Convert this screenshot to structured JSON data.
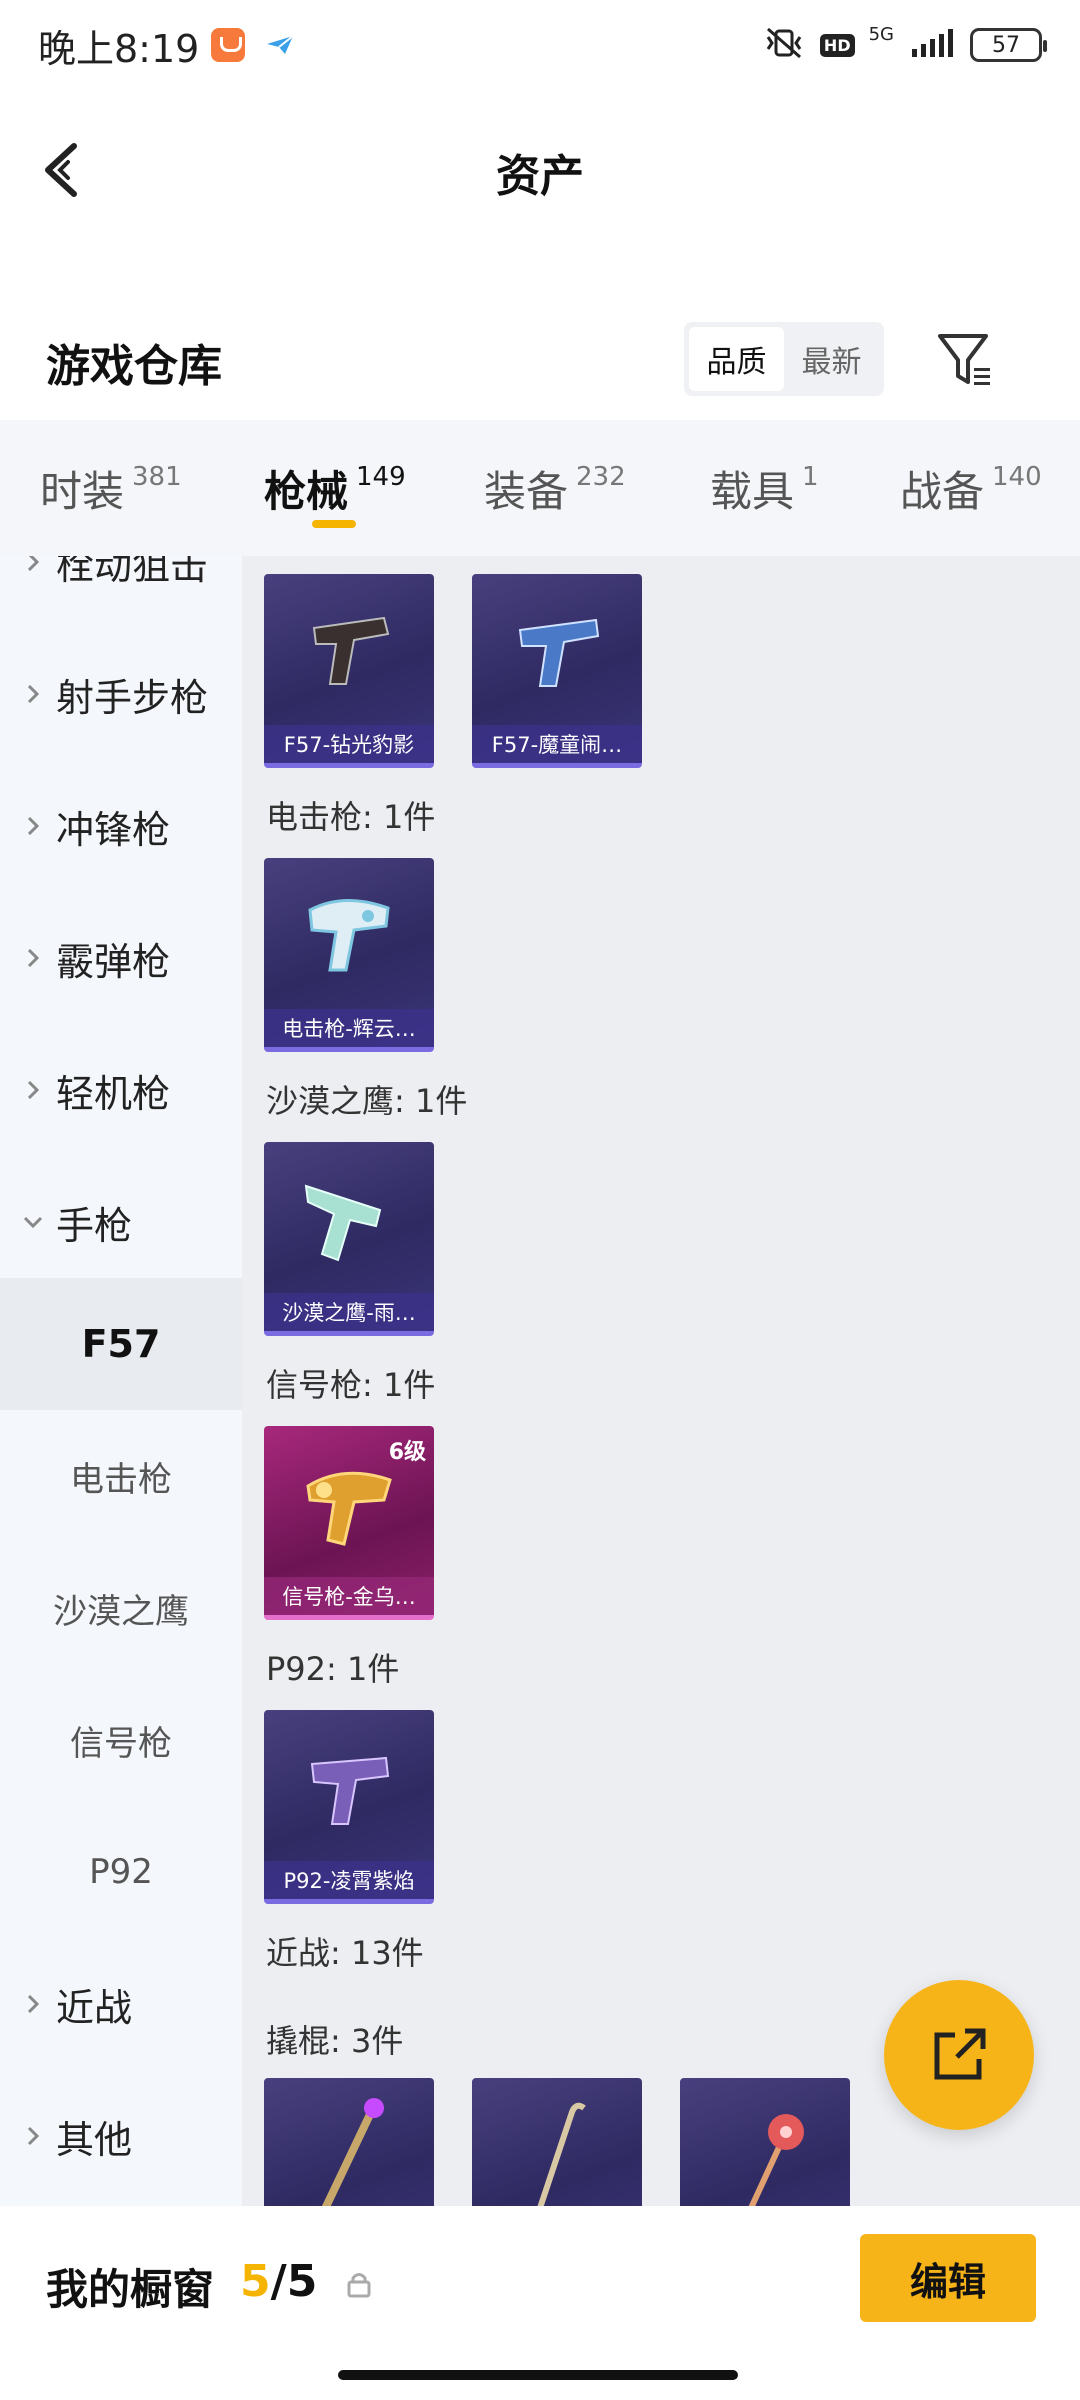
{
  "status_bar": {
    "time": "晚上8:19",
    "hd": "HD",
    "network": "5G",
    "battery": "57"
  },
  "header": {
    "title": "资产"
  },
  "warehouse": {
    "title": "游戏仓库",
    "sort": [
      "品质",
      "最新"
    ],
    "active_sort": "品质"
  },
  "tabs": [
    {
      "label": "时装",
      "count": "381"
    },
    {
      "label": "枪械",
      "count": "149"
    },
    {
      "label": "装备",
      "count": "232"
    },
    {
      "label": "载具",
      "count": "1"
    },
    {
      "label": "战备",
      "count": "140"
    }
  ],
  "sidebar": {
    "categories": {
      "partial": "栓动狙击",
      "marksman": "射手步枪",
      "smg": "冲锋枪",
      "shotgun": "霰弹枪",
      "lmg": "轻机枪",
      "pistol": "手枪",
      "melee": "近战",
      "other": "其他"
    },
    "pistol_subs": [
      "F57",
      "电击枪",
      "沙漠之鹰",
      "信号枪",
      "P92"
    ]
  },
  "main": {
    "f57_items": [
      "F57-钻光豹影",
      "F57-魔童闹…"
    ],
    "stun_section": "电击枪: 1件",
    "stun_items": [
      "电击枪-辉云…"
    ],
    "deagle_section": "沙漠之鹰: 1件",
    "deagle_items": [
      "沙漠之鹰-雨…"
    ],
    "flare_section": "信号枪: 1件",
    "flare_items": [
      "信号枪-金乌…"
    ],
    "flare_level": "6级",
    "p92_section": "P92: 1件",
    "p92_items": [
      "P92-凌霄紫焰"
    ],
    "melee_section": "近战: 13件",
    "crowbar_section": "撬棍: 3件"
  },
  "bottom_bar": {
    "title": "我的橱窗",
    "current": "5",
    "separator": "/",
    "total": "5",
    "edit": "编辑"
  },
  "colors": {
    "accent": "#f5b400",
    "card_purple": "#2f2a62",
    "card_pink": "#8a2068"
  }
}
